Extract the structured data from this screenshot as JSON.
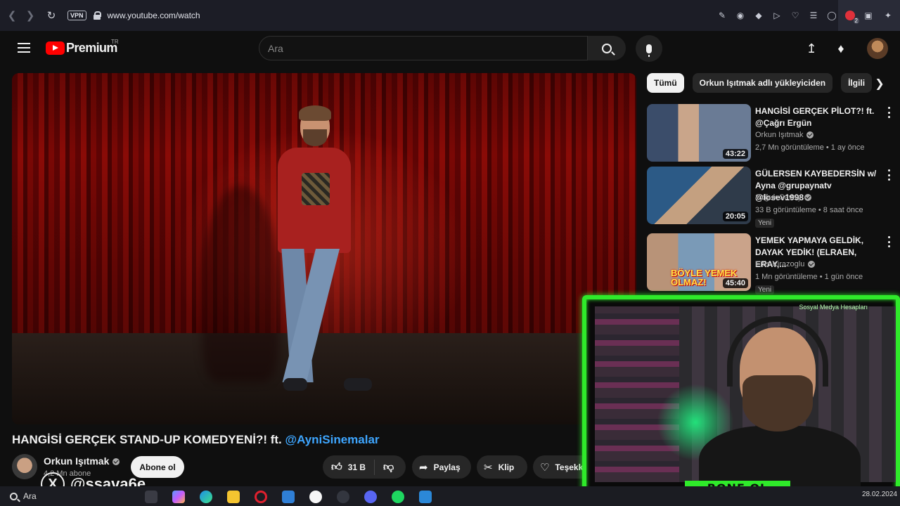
{
  "browser": {
    "vpn_label": "VPN",
    "url": "www.youtube.com/watch",
    "badge_count": "2"
  },
  "header": {
    "logo_text": "Premium",
    "logo_region": "TR",
    "search_placeholder": "Ara"
  },
  "video": {
    "title_main": "HANGİSİ GERÇEK STAND-UP KOMEDYENİ?! ft. ",
    "title_tag": "@AyniSinemalar",
    "channel": "Orkun Işıtmak",
    "subscribers": "4,2 Mn abone",
    "subscribe_label": "Abone ol",
    "likes": "31 B",
    "share_label": "Paylaş",
    "clip_label": "Klip",
    "thanks_label": "Teşekk"
  },
  "sidebar": {
    "chips": [
      {
        "label": "Tümü",
        "active": true
      },
      {
        "label": "Orkun Işıtmak adlı yükleyiciden",
        "active": false
      },
      {
        "label": "İlgili",
        "active": false
      }
    ],
    "recommendations": [
      {
        "title": "HANGİSİ GERÇEK PİLOT?! ft. @Çağrı Ergün",
        "channel": "Orkun Işıtmak",
        "verified": true,
        "meta": "2,7 Mn görüntüleme • 1 ay önce",
        "duration": "43:22",
        "badge": ""
      },
      {
        "title": "GÜLERSEN KAYBEDERSİN w/ Ayna @grupaynatv @losev1998",
        "channel": "Soğuk Savaş",
        "verified": true,
        "meta": "33 B görüntüleme • 8 saat önce",
        "duration": "20:05",
        "badge": "Yeni"
      },
      {
        "title": "YEMEK YAPMAYA GELDİK, DAYAK YEDİK! (ELRAEN, ERAY,...",
        "channel": "Enis Kirazoglu",
        "verified": true,
        "meta": "1 Mn görüntüleme • 1 gün önce",
        "duration": "45:40",
        "badge": "Yeni",
        "thumb_caption": "BÖYLE YEMEK OLMAZ!"
      }
    ]
  },
  "overlay": {
    "handle": "@ssava6e",
    "banner": "BONE OL",
    "top_label": "Sosyal Medya Hesapları"
  },
  "taskbar": {
    "search_label": "Ara",
    "date": "28.02.2024"
  },
  "colors": {
    "accent_red": "#ff0000",
    "link_blue": "#3ea6ff",
    "overlay_green": "#2fea2a"
  }
}
